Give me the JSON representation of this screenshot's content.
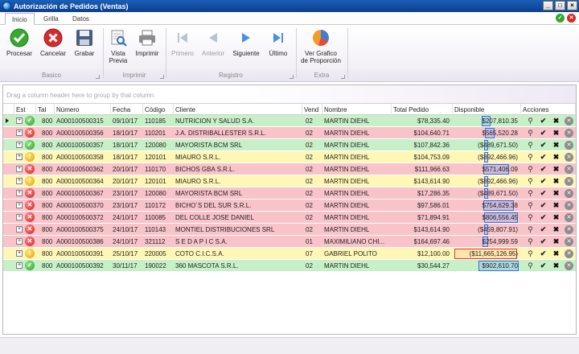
{
  "window": {
    "title": "Autorización de Pedidos (Ventas)",
    "buttons": [
      "_",
      "□",
      "×"
    ]
  },
  "tabs": [
    {
      "label": "Inicio",
      "active": true
    },
    {
      "label": "Grilla",
      "active": false
    },
    {
      "label": "Datos",
      "active": false
    }
  ],
  "ribbon": {
    "basico": {
      "label": "Basico",
      "procesar": "Procesar",
      "cancelar": "Cancelar",
      "grabar": "Grabar"
    },
    "imprimir": {
      "label": "Imprimir",
      "vista_previa_1": "Vista",
      "vista_previa_2": "Previa",
      "imprimir": "Imprimir"
    },
    "registro": {
      "label": "Registro",
      "primero": "Primero",
      "anterior": "Anterior",
      "siguiente": "Siguiente",
      "ultimo": "Último"
    },
    "extra": {
      "label": "Extra",
      "grafico_1": "Ver Grafico",
      "grafico_2": "de Proporción"
    }
  },
  "grid": {
    "group_hint": "Drag a column header here to group by that column",
    "columns": {
      "est": "Est",
      "tal": "Tal",
      "numero": "Número",
      "fecha": "Fecha",
      "codigo": "Código",
      "cliente": "Cliente",
      "vend": "Vend",
      "nombre": "Nombre",
      "total": "Total Pedido",
      "disponible": "Disponible",
      "acciones": "Acciones"
    },
    "rows": [
      {
        "status": "ok",
        "color": "green",
        "tal": "800",
        "numero": "A000100500315",
        "fecha": "09/10/17",
        "codigo": "110185",
        "cliente": "NUTRICION Y SALUD S.A.",
        "vend": "02",
        "nombre": "MARTIN DIEHL",
        "total": "$78,335.40",
        "disponible": "$207,810.35"
      },
      {
        "status": "bad",
        "color": "red",
        "tal": "800",
        "numero": "A000100500356",
        "fecha": "18/10/17",
        "codigo": "110201",
        "cliente": "J.A. DISTRIBALLESTER S.R.L.",
        "vend": "02",
        "nombre": "MARTIN DIEHL",
        "total": "$104,640.71",
        "disponible": "$565,520.28"
      },
      {
        "status": "ok",
        "color": "green",
        "tal": "800",
        "numero": "A000100500357",
        "fecha": "18/10/17",
        "codigo": "120080",
        "cliente": "MAYORISTA BCM SRL",
        "vend": "02",
        "nombre": "MARTIN DIEHL",
        "total": "$107,842.36",
        "disponible": "($489,671.50)"
      },
      {
        "status": "warn",
        "color": "yellow",
        "tal": "800",
        "numero": "A000100500358",
        "fecha": "18/10/17",
        "codigo": "120101",
        "cliente": "MIAURO S.R.L.",
        "vend": "02",
        "nombre": "MARTIN DIEHL",
        "total": "$104,753.09",
        "disponible": "($892,466.96)"
      },
      {
        "status": "bad",
        "color": "red",
        "tal": "800",
        "numero": "A000100500362",
        "fecha": "20/10/17",
        "codigo": "110170",
        "cliente": "BICHOS GBA S.R.L.",
        "vend": "02",
        "nombre": "MARTIN DIEHL",
        "total": "$111,966.63",
        "disponible": "$571,406.09"
      },
      {
        "status": "warn",
        "color": "yellow",
        "tal": "800",
        "numero": "A000100500364",
        "fecha": "20/10/17",
        "codigo": "120101",
        "cliente": "MIAURO S.R.L.",
        "vend": "02",
        "nombre": "MARTIN DIEHL",
        "total": "$143,614.90",
        "disponible": "($892,466.96)"
      },
      {
        "status": "bad",
        "color": "red",
        "tal": "800",
        "numero": "A000100500367",
        "fecha": "23/10/17",
        "codigo": "120080",
        "cliente": "MAYORISTA BCM SRL",
        "vend": "02",
        "nombre": "MARTIN DIEHL",
        "total": "$17,286.35",
        "disponible": "($489,671.50)"
      },
      {
        "status": "bad",
        "color": "red",
        "tal": "800",
        "numero": "A000100500370",
        "fecha": "23/10/17",
        "codigo": "110172",
        "cliente": "BICHO´S DEL SUR S.R.L.",
        "vend": "02",
        "nombre": "MARTIN DIEHL",
        "total": "$97,586.01",
        "disponible": "$754,629.38"
      },
      {
        "status": "bad",
        "color": "red",
        "tal": "800",
        "numero": "A000100500372",
        "fecha": "24/10/17",
        "codigo": "110085",
        "cliente": "DEL COLLE JOSE DANIEL",
        "vend": "02",
        "nombre": "MARTIN DIEHL",
        "total": "$71,894.91",
        "disponible": "$806,556.45"
      },
      {
        "status": "bad",
        "color": "red",
        "tal": "800",
        "numero": "A000100500375",
        "fecha": "24/10/17",
        "codigo": "110143",
        "cliente": "MONTIEL DISTRIBUCIONES SRL",
        "vend": "02",
        "nombre": "MARTIN DIEHL",
        "total": "$143,614.90",
        "disponible": "($459,807.91)"
      },
      {
        "status": "bad",
        "color": "red",
        "tal": "800",
        "numero": "A000100500386",
        "fecha": "24/10/17",
        "codigo": "321112",
        "cliente": "S E D A P I C S.A.",
        "vend": "01",
        "nombre": "MAXIMILIANO CHI...",
        "total": "$164,697.46",
        "disponible": "$254,999.59"
      },
      {
        "status": "warn",
        "color": "yellow",
        "tal": "800",
        "numero": "A000100500391",
        "fecha": "25/10/17",
        "codigo": "220005",
        "cliente": "COTO C.I.C.S.A.",
        "vend": "07",
        "nombre": "GABRIEL POLITO",
        "total": "$12,100.00",
        "disponible": "($11,665,126.95)"
      },
      {
        "status": "ok",
        "color": "green",
        "tal": "800",
        "numero": "A000100500392",
        "fecha": "30/11/17",
        "codigo": "190022",
        "cliente": "360 MASCOTA S.R.L.",
        "vend": "02",
        "nombre": "MARTIN DIEHL",
        "total": "$30,544.27",
        "disponible": "$902,610.70"
      }
    ]
  },
  "colors": {
    "green_row": "#c7f0c8",
    "red_row": "#f8c3c9",
    "yellow_row": "#fff7b6",
    "title_bar": "#1a5fb8"
  }
}
